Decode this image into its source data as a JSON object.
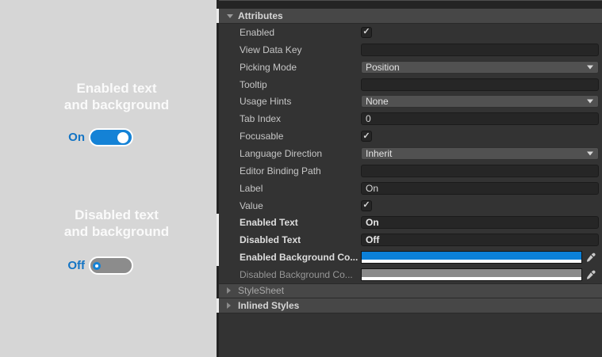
{
  "icons": {
    "check": "✓"
  },
  "colors": {
    "toggle_on_blue": "#1482d6",
    "toggle_off_gray": "#8c8c8c",
    "label_blue": "#1374c4"
  },
  "preview": {
    "groups": [
      {
        "heading_line1": "Enabled text",
        "heading_line2": "and background",
        "toggle_label": "On",
        "state": "on"
      },
      {
        "heading_line1": "Disabled text",
        "heading_line2": "and background",
        "toggle_label": "Off",
        "state": "off"
      }
    ]
  },
  "inspector": {
    "attributes": {
      "title": "Attributes",
      "rows": [
        {
          "label": "Enabled",
          "type": "checkbox",
          "checked": true
        },
        {
          "label": "View Data Key",
          "type": "text",
          "value": ""
        },
        {
          "label": "Picking Mode",
          "type": "dropdown",
          "value": "Position"
        },
        {
          "label": "Tooltip",
          "type": "text",
          "value": ""
        },
        {
          "label": "Usage Hints",
          "type": "dropdown",
          "value": "None"
        },
        {
          "label": "Tab Index",
          "type": "text",
          "value": "0"
        },
        {
          "label": "Focusable",
          "type": "checkbox",
          "checked": true
        },
        {
          "label": "Language Direction",
          "type": "dropdown",
          "value": "Inherit"
        },
        {
          "label": "Editor Binding Path",
          "type": "text",
          "value": ""
        },
        {
          "label": "Label",
          "type": "text",
          "value": "On"
        },
        {
          "label": "Value",
          "type": "checkbox",
          "checked": true
        },
        {
          "label": "Enabled Text",
          "type": "text",
          "value": "On",
          "bold": true,
          "override": true
        },
        {
          "label": "Disabled Text",
          "type": "text",
          "value": "Off",
          "bold": true,
          "override": true
        },
        {
          "label": "Enabled Background Co...",
          "type": "color",
          "color": "#0b80d8",
          "bold": true,
          "override": true
        },
        {
          "label": "Disabled Background Co...",
          "type": "color",
          "color": "#8a8a8a",
          "dimmed": true
        }
      ]
    },
    "foldouts": [
      {
        "title": "StyleSheet"
      },
      {
        "title": "Inlined Styles",
        "bold": true,
        "override": true
      }
    ]
  }
}
